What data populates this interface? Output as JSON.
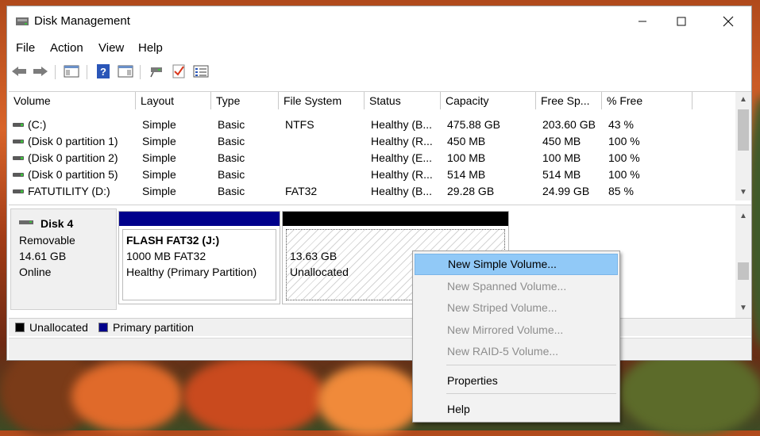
{
  "window": {
    "title": "Disk Management"
  },
  "menu": [
    "File",
    "Action",
    "View",
    "Help"
  ],
  "toolbar": {
    "icons": [
      "back-arrow-icon",
      "forward-arrow-icon",
      "show-hide-console-tree-icon",
      "help-icon",
      "properties-pane-icon",
      "connect-virtual-disk-icon",
      "checklist-icon",
      "list-view-icon"
    ]
  },
  "volume_list": {
    "columns": [
      "Volume",
      "Layout",
      "Type",
      "File System",
      "Status",
      "Capacity",
      "Free Sp...",
      "% Free"
    ],
    "rows": [
      {
        "volume": "(C:)",
        "layout": "Simple",
        "type": "Basic",
        "fs": "NTFS",
        "status": "Healthy (B...",
        "capacity": "475.88 GB",
        "free": "203.60 GB",
        "pct": "43 %"
      },
      {
        "volume": "(Disk 0 partition 1)",
        "layout": "Simple",
        "type": "Basic",
        "fs": "",
        "status": "Healthy (R...",
        "capacity": "450 MB",
        "free": "450 MB",
        "pct": "100 %"
      },
      {
        "volume": "(Disk 0 partition 2)",
        "layout": "Simple",
        "type": "Basic",
        "fs": "",
        "status": "Healthy (E...",
        "capacity": "100 MB",
        "free": "100 MB",
        "pct": "100 %"
      },
      {
        "volume": "(Disk 0 partition 5)",
        "layout": "Simple",
        "type": "Basic",
        "fs": "",
        "status": "Healthy (R...",
        "capacity": "514 MB",
        "free": "514 MB",
        "pct": "100 %"
      },
      {
        "volume": "FATUTILITY (D:)",
        "layout": "Simple",
        "type": "Basic",
        "fs": "FAT32",
        "status": "Healthy (B...",
        "capacity": "29.28 GB",
        "free": "24.99 GB",
        "pct": "85 %"
      }
    ]
  },
  "disk": {
    "name": "Disk 4",
    "kind": "Removable",
    "size": "14.61 GB",
    "state": "Online",
    "partitions": [
      {
        "title": "FLASH FAT32  (J:)",
        "line1": "1000 MB FAT32",
        "line2": "Healthy (Primary Partition)",
        "color": "#00008b"
      },
      {
        "title": "",
        "line1": "13.63 GB",
        "line2": "Unallocated",
        "color": "#000000"
      }
    ]
  },
  "legend": [
    {
      "label": "Unallocated",
      "color": "#000000"
    },
    {
      "label": "Primary partition",
      "color": "#00008b"
    }
  ],
  "context_menu": {
    "items": [
      {
        "label": "New Simple Volume...",
        "state": "highlighted"
      },
      {
        "label": "New Spanned Volume...",
        "state": "disabled"
      },
      {
        "label": "New Striped Volume...",
        "state": "disabled"
      },
      {
        "label": "New Mirrored Volume...",
        "state": "disabled"
      },
      {
        "label": "New RAID-5 Volume...",
        "state": "disabled"
      },
      {
        "label": "Properties",
        "state": "enabled"
      },
      {
        "label": "Help",
        "state": "enabled"
      }
    ]
  }
}
